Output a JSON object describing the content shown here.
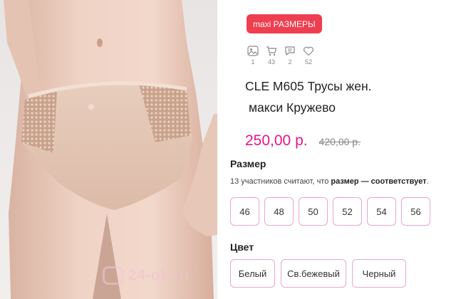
{
  "badge": {
    "label": "maxi РАЗМЕРЫ"
  },
  "stats": [
    {
      "icon": "photo-icon",
      "count": "1"
    },
    {
      "icon": "cart-icon",
      "count": "43"
    },
    {
      "icon": "comment-icon",
      "count": "2"
    },
    {
      "icon": "heart-icon",
      "count": "52"
    }
  ],
  "product": {
    "title_line1": "CLE M605 Трусы жен.",
    "title_line2": "макси Кружево",
    "price": "250,00 р.",
    "old_price": "420,00 р."
  },
  "size_section": {
    "heading": "Размер",
    "note_prefix": "13 участников считают, что ",
    "note_bold": "размер — соответствует",
    "note_suffix": ".",
    "options": [
      "46",
      "48",
      "50",
      "52",
      "54",
      "56"
    ]
  },
  "color_section": {
    "heading": "Цвет",
    "options": [
      "Белый",
      "Св.бежевый",
      "Черный"
    ]
  },
  "watermark": {
    "text": "24-ok.ru"
  },
  "colors": {
    "accent_price": "#e5168a",
    "badge_bg": "#ef3e4f",
    "option_border": "#e7a6d0"
  }
}
